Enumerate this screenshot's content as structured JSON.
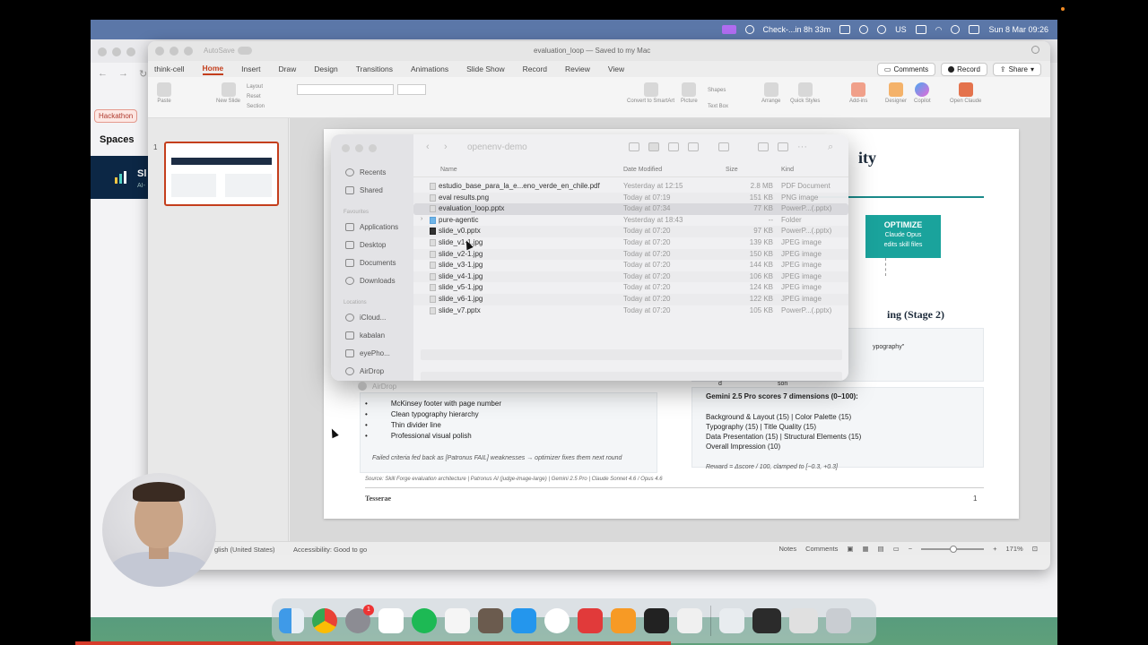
{
  "menubar": {
    "reminder": "Check-...in 8h 33m",
    "datetime": "Sun 8 Mar  09:26",
    "us_label": "US"
  },
  "browser": {
    "hackathon_tab": "Hackathon",
    "spaces_title": "Spaces",
    "spaces_band_title": "Sl",
    "spaces_band_sub": "AI-"
  },
  "ppt": {
    "autosave": "AutoSave",
    "doc_title": "evaluation_loop — Saved to my Mac",
    "tabs": [
      "think-cell",
      "Home",
      "Insert",
      "Draw",
      "Design",
      "Transitions",
      "Animations",
      "Slide Show",
      "Record",
      "Review",
      "View"
    ],
    "active_tab": "Home",
    "comments_button": "Comments",
    "record_button": "Record",
    "share_button": "Share",
    "ribbon": {
      "paste": "Paste",
      "new_slide": "New Slide",
      "layout": "Layout",
      "reset": "Reset",
      "section": "Section",
      "convert": "Convert to SmartArt",
      "picture": "Picture",
      "shapes": "Shapes",
      "textbox": "Text Box",
      "arrange": "Arrange",
      "quick_styles": "Quick Styles",
      "addins": "Add-ins",
      "designer": "Designer",
      "copilot": "Copilot",
      "open_claude": "Open Claude"
    },
    "slide_number": "1",
    "slide": {
      "heading_fragment": "ity",
      "optimize_title": "OPTIMIZE",
      "optimize_line1": "Claude Opus",
      "optimize_line2": "edits skill files",
      "stage2_fragment": "ing (Stage 2)",
      "typography_fragment": "ypography\"",
      "d_fragment": "d",
      "son_fragment": "son",
      "bullets": [
        "McKinsey footer with page number",
        "Clean typography hierarchy",
        "Thin divider line",
        "Professional visual polish"
      ],
      "failed_note": "Failed criteria fed back as [Patronus FAIL] weaknesses → optimizer fixes them next round",
      "gemini_title": "Gemini 2.5 Pro scores 7 dimensions (0–100):",
      "criteria": [
        "Background & Layout (15)  |  Color Palette (15)",
        "Typography (15)  |  Title Quality (15)",
        "Data Presentation (15)  |  Structural Elements (15)",
        "Overall Impression (10)"
      ],
      "reward": "Reward = Δscore / 100, clamped to [−0.3, +0.3]",
      "source": "Source: Skill Forge evaluation architecture  |  Patronus AI (judge-image-large)  |  Gemini 2.5 Pro  |  Claude Sonnet 4.6 / Opus 4.6",
      "footer_brand": "Tesserae",
      "page_number": "1"
    },
    "status": {
      "language": "glish (United States)",
      "accessibility": "Accessibility: Good to go",
      "notes": "Notes",
      "comments": "Comments",
      "zoom": "171%"
    }
  },
  "finder": {
    "folder": "openenv-demo",
    "sidebar": {
      "recents": "Recents",
      "shared": "Shared",
      "favourites_header": "Favourites",
      "applications": "Applications",
      "desktop": "Desktop",
      "documents": "Documents",
      "downloads": "Downloads",
      "locations_header": "Locations",
      "icloud": "iCloud...",
      "kabalan": "kabalan",
      "eyephone": "eyePho...",
      "airdrop": "AirDrop"
    },
    "columns": {
      "name": "Name",
      "date": "Date Modified",
      "size": "Size",
      "kind": "Kind"
    },
    "files": [
      {
        "name": "estudio_base_para_la_e...eno_verde_en_chile.pdf",
        "date": "Yesterday at 12:15",
        "size": "2.8 MB",
        "kind": "PDF Document"
      },
      {
        "name": "eval results.png",
        "date": "Today at 07:19",
        "size": "151 KB",
        "kind": "PNG image"
      },
      {
        "name": "evaluation_loop.pptx",
        "date": "Today at 07:34",
        "size": "77 KB",
        "kind": "PowerP...(.pptx)"
      },
      {
        "name": "pure-agentic",
        "date": "Yesterday at 18:43",
        "size": "--",
        "kind": "Folder"
      },
      {
        "name": "slide_v0.pptx",
        "date": "Today at 07:20",
        "size": "97 KB",
        "kind": "PowerP...(.pptx)"
      },
      {
        "name": "slide_v1-1.jpg",
        "date": "Today at 07:20",
        "size": "139 KB",
        "kind": "JPEG image"
      },
      {
        "name": "slide_v2-1.jpg",
        "date": "Today at 07:20",
        "size": "150 KB",
        "kind": "JPEG image"
      },
      {
        "name": "slide_v3-1.jpg",
        "date": "Today at 07:20",
        "size": "144 KB",
        "kind": "JPEG image"
      },
      {
        "name": "slide_v4-1.jpg",
        "date": "Today at 07:20",
        "size": "106 KB",
        "kind": "JPEG image"
      },
      {
        "name": "slide_v5-1.jpg",
        "date": "Today at 07:20",
        "size": "124 KB",
        "kind": "JPEG image"
      },
      {
        "name": "slide_v6-1.jpg",
        "date": "Today at 07:20",
        "size": "122 KB",
        "kind": "JPEG image"
      },
      {
        "name": "slide_v7.pptx",
        "date": "Today at 07:20",
        "size": "105 KB",
        "kind": "PowerP...(.pptx)"
      }
    ],
    "selected_index": 2,
    "airdrop_below": "AirDrop"
  },
  "dock": {
    "badge_count": "1",
    "apps": [
      "finder-icon",
      "chrome-icon",
      "system-settings-icon",
      "arc-icon",
      "spotify-icon",
      "writer-icon",
      "gimp-icon",
      "docker-icon",
      "chatgpt-icon",
      "acrobat-icon",
      "sublime-icon",
      "terminal-icon",
      "preview-icon",
      "documents-icon",
      "window-icon",
      "trash-icon"
    ]
  }
}
